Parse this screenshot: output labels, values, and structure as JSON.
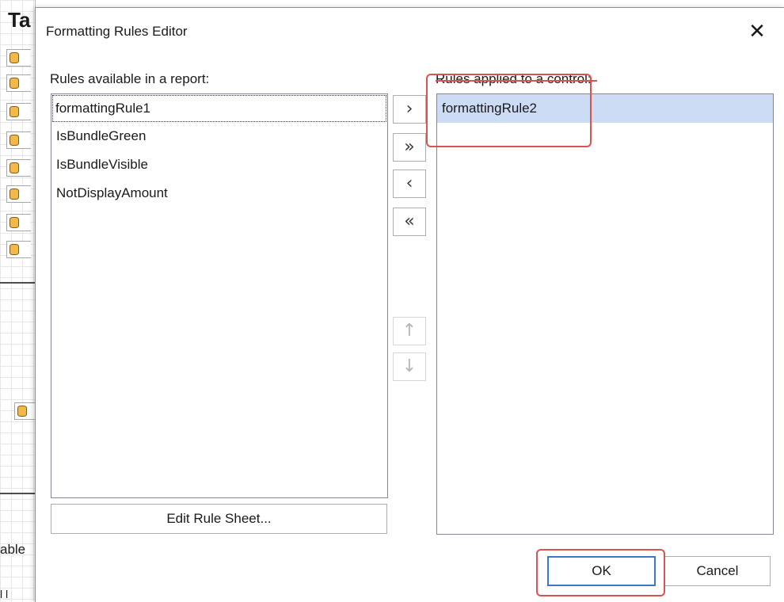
{
  "background": {
    "title_fragment": "Ta",
    "table_fragment": "able",
    "ruler_fragment": "l l"
  },
  "dialog": {
    "title": "Formatting Rules Editor",
    "close_glyph": "✕"
  },
  "available": {
    "label": "Rules available in a report:",
    "items": [
      "formattingRule1",
      "IsBundleGreen",
      "IsBundleVisible",
      "NotDisplayAmount"
    ]
  },
  "applied": {
    "label": "Rules applied to a control:",
    "items": [
      "formattingRule2"
    ]
  },
  "move_buttons": {
    "add_one": "›",
    "add_all": "»",
    "remove_one": "‹",
    "remove_all": "«",
    "move_up": "↑",
    "move_down": "↓"
  },
  "buttons": {
    "edit_rule_sheet": "Edit Rule Sheet...",
    "ok": "OK",
    "cancel": "Cancel"
  },
  "colors": {
    "annotation": "#d9534f",
    "selection": "#cddcf5",
    "default_button_border": "#3c78c8"
  }
}
